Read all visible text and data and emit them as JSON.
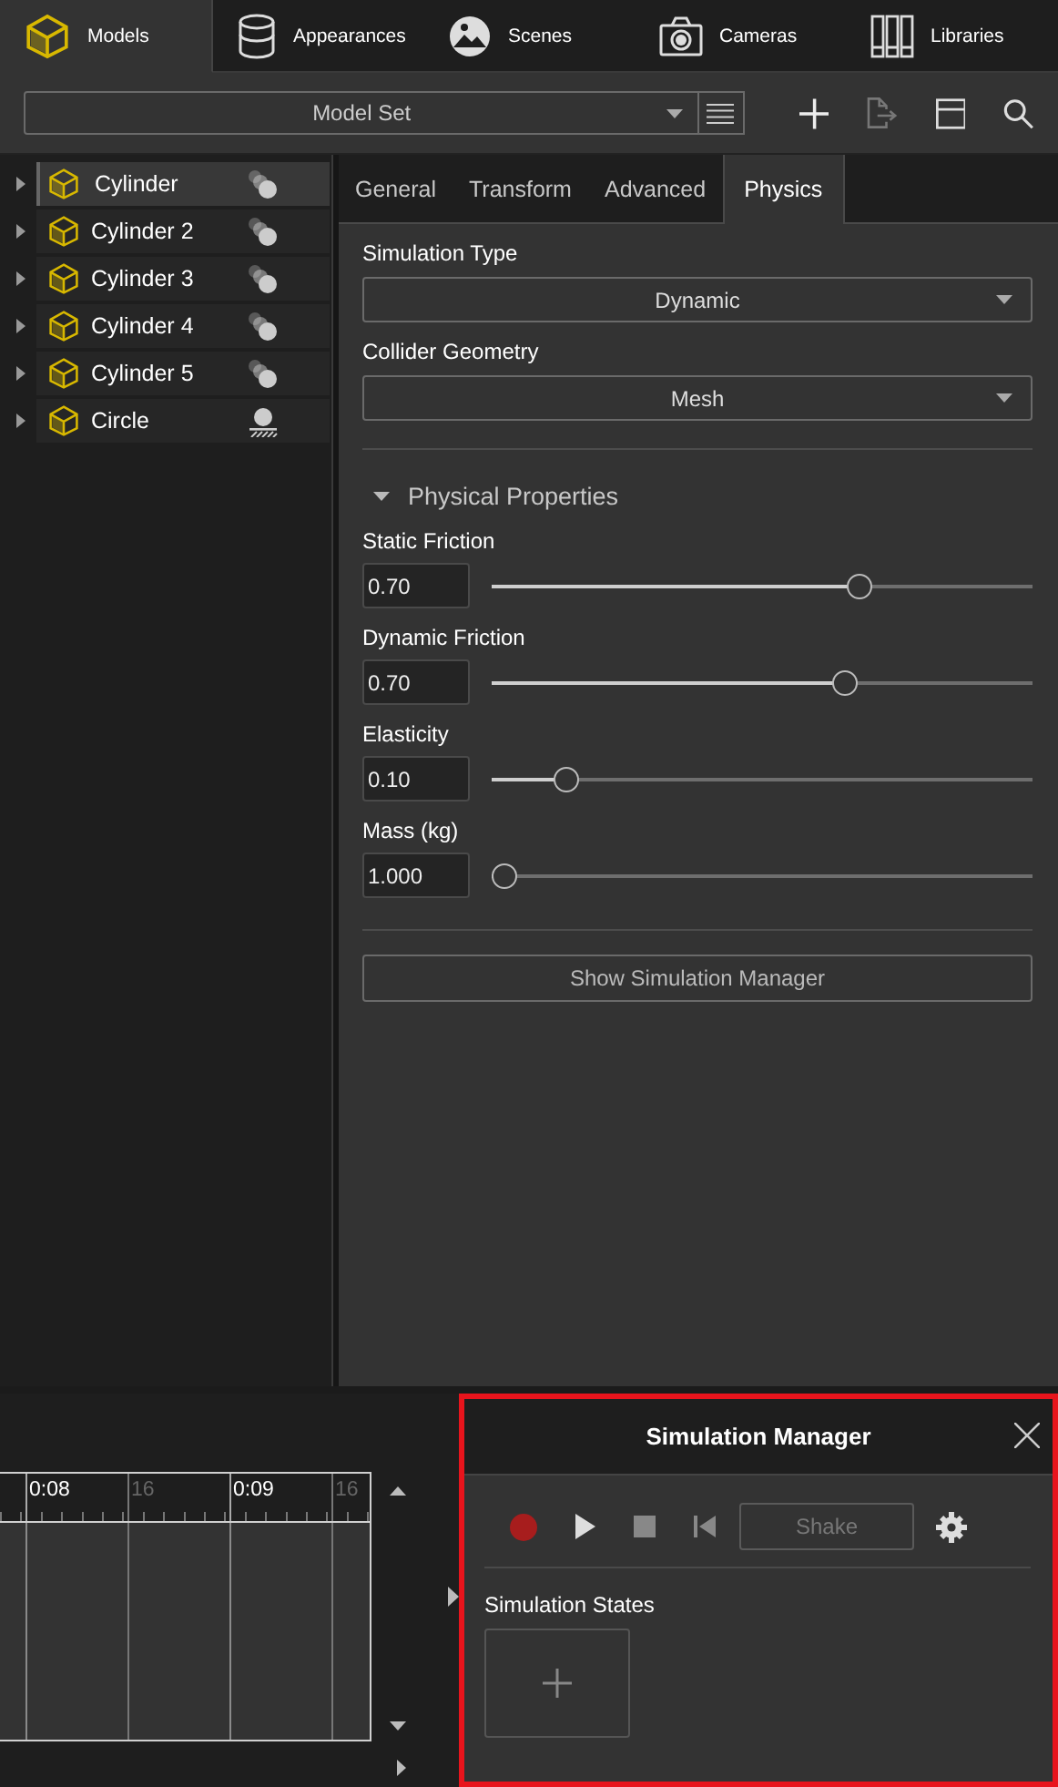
{
  "top_tabs": [
    {
      "label": "Models",
      "selected": true
    },
    {
      "label": "Appearances",
      "selected": false
    },
    {
      "label": "Scenes",
      "selected": false
    },
    {
      "label": "Cameras",
      "selected": false
    },
    {
      "label": "Libraries",
      "selected": false
    }
  ],
  "toolbar": {
    "model_set": "Model Set"
  },
  "tree": [
    {
      "label": "Cylinder",
      "selected": true,
      "expanded": false,
      "kind": "dynamic"
    },
    {
      "label": "Cylinder 2",
      "selected": false,
      "expanded": false,
      "kind": "dynamic"
    },
    {
      "label": "Cylinder 3",
      "selected": false,
      "expanded": false,
      "kind": "dynamic"
    },
    {
      "label": "Cylinder 4",
      "selected": false,
      "expanded": false,
      "kind": "dynamic"
    },
    {
      "label": "Cylinder 5",
      "selected": false,
      "expanded": false,
      "kind": "dynamic"
    },
    {
      "label": "Circle",
      "selected": false,
      "expanded": false,
      "kind": "static"
    }
  ],
  "property_tabs": [
    {
      "label": "General",
      "selected": false
    },
    {
      "label": "Transform",
      "selected": false
    },
    {
      "label": "Advanced",
      "selected": false
    },
    {
      "label": "Physics",
      "selected": true
    }
  ],
  "dropdowns": [
    {
      "label": "Simulation Type",
      "value": "Dynamic"
    },
    {
      "label": "Collider Geometry",
      "value": "Mesh"
    }
  ],
  "section": {
    "label": "Physical Properties",
    "expanded": true
  },
  "sliders": [
    {
      "label": "Static Friction",
      "value": "0.70",
      "level": 0.69
    },
    {
      "label": "Dynamic Friction",
      "value": "0.70",
      "level": 0.66
    },
    {
      "label": "Elasticity",
      "value": "0.10",
      "level": 0.12
    },
    {
      "label": "Mass (kg)",
      "value": "1.000",
      "level": 0
    }
  ],
  "show_button": "Show Simulation Manager",
  "timeline": {
    "ticks": [
      {
        "label": "0:08",
        "kind": "major"
      },
      {
        "label": "16",
        "kind": "minor"
      },
      {
        "label": "0:09",
        "kind": "major"
      },
      {
        "label": "16",
        "kind": "minor"
      }
    ]
  },
  "simulation_manager": {
    "title": "Simulation Manager",
    "highlighted": true,
    "shake": {
      "label": "Shake",
      "disabled": true
    },
    "states_label": "Simulation States"
  }
}
